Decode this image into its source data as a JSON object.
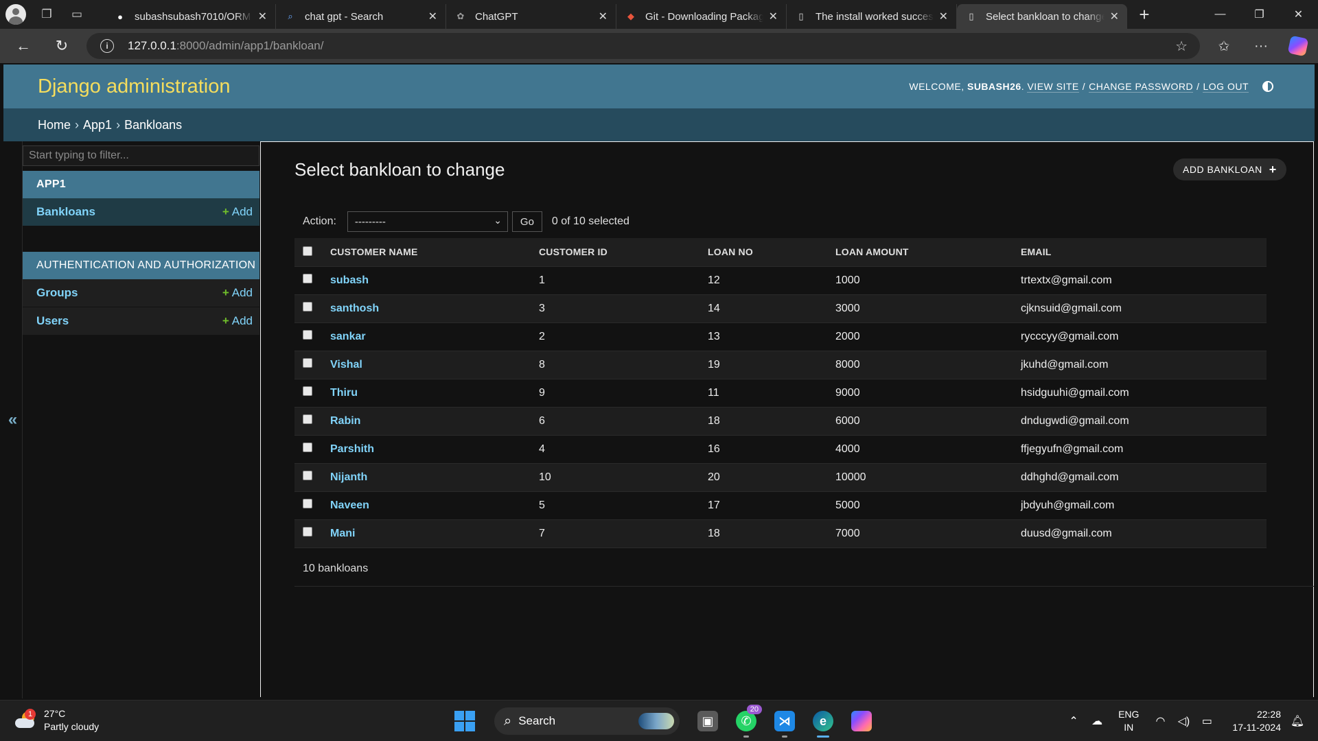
{
  "browser": {
    "tabs": [
      {
        "title": "subashsubash7010/ORM",
        "icon": "github-icon",
        "active": false
      },
      {
        "title": "chat gpt - Search",
        "icon": "search-icon",
        "active": false
      },
      {
        "title": "ChatGPT",
        "icon": "chatgpt-icon",
        "active": false
      },
      {
        "title": "Git - Downloading Package",
        "icon": "git-icon",
        "active": false
      },
      {
        "title": "The install worked successfully",
        "icon": "page-icon",
        "active": false
      },
      {
        "title": "Select bankloan to change",
        "icon": "page-icon",
        "active": true
      }
    ],
    "url_host": "127.0.0.1",
    "url_path": ":8000/admin/app1/bankloan/"
  },
  "header": {
    "branding": "Django administration",
    "welcome": "WELCOME,",
    "username": "SUBASH26",
    "view_site": "VIEW SITE",
    "change_password": "CHANGE PASSWORD",
    "log_out": "LOG OUT"
  },
  "breadcrumbs": {
    "home": "Home",
    "app": "App1",
    "current": "Bankloans"
  },
  "sidebar": {
    "filter_placeholder": "Start typing to filter...",
    "toggle": "«",
    "modules": [
      {
        "caption": "APP1",
        "models": [
          {
            "name": "Bankloans",
            "add": "Add",
            "current": true
          }
        ]
      },
      {
        "caption": "AUTHENTICATION AND AUTHORIZATION",
        "models": [
          {
            "name": "Groups",
            "add": "Add"
          },
          {
            "name": "Users",
            "add": "Add"
          }
        ]
      }
    ]
  },
  "main": {
    "title": "Select bankloan to change",
    "add_button": "ADD BANKLOAN",
    "action_label": "Action:",
    "action_selected": "---------",
    "go_button": "Go",
    "counter": "0 of 10 selected",
    "columns": [
      "CUSTOMER NAME",
      "CUSTOMER ID",
      "LOAN NO",
      "LOAN AMOUNT",
      "EMAIL"
    ],
    "rows": [
      {
        "name": "subash",
        "customer_id": "1",
        "loan_no": "12",
        "loan_amount": "1000",
        "email": "trtextx@gmail.com"
      },
      {
        "name": "santhosh",
        "customer_id": "3",
        "loan_no": "14",
        "loan_amount": "3000",
        "email": "cjknsuid@gmail.com"
      },
      {
        "name": "sankar",
        "customer_id": "2",
        "loan_no": "13",
        "loan_amount": "2000",
        "email": "rycccyy@gmail.com"
      },
      {
        "name": "Vishal",
        "customer_id": "8",
        "loan_no": "19",
        "loan_amount": "8000",
        "email": "jkuhd@gmail.com"
      },
      {
        "name": "Thiru",
        "customer_id": "9",
        "loan_no": "11",
        "loan_amount": "9000",
        "email": "hsidguuhi@gmail.com"
      },
      {
        "name": "Rabin",
        "customer_id": "6",
        "loan_no": "18",
        "loan_amount": "6000",
        "email": "dndugwdi@gmail.com"
      },
      {
        "name": "Parshith",
        "customer_id": "4",
        "loan_no": "16",
        "loan_amount": "4000",
        "email": "ffjegyufn@gmail.com"
      },
      {
        "name": "Nijanth",
        "customer_id": "10",
        "loan_no": "20",
        "loan_amount": "10000",
        "email": "ddhghd@gmail.com"
      },
      {
        "name": "Naveen",
        "customer_id": "5",
        "loan_no": "17",
        "loan_amount": "5000",
        "email": "jbdyuh@gmail.com"
      },
      {
        "name": "Mani",
        "customer_id": "7",
        "loan_no": "18",
        "loan_amount": "7000",
        "email": "duusd@gmail.com"
      }
    ],
    "paginator": "10 bankloans"
  },
  "taskbar": {
    "temperature": "27°C",
    "weather": "Partly cloudy",
    "weather_badge": "1",
    "search": "Search",
    "whatsapp_count": "20",
    "lang_top": "ENG",
    "lang_bottom": "IN",
    "time": "22:28",
    "date": "17-11-2024"
  },
  "colors": {
    "header_bg": "#417690",
    "breadcrumb_bg": "#264b5d",
    "branding": "#f5dd5d",
    "link": "#81d4fa",
    "add_plus": "#70bf2b"
  }
}
